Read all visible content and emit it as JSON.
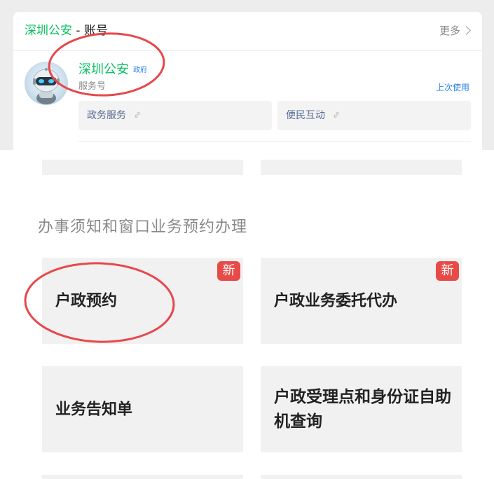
{
  "account_card": {
    "title_prefix": "深圳公安",
    "title_suffix": " - 账号",
    "more_label": "更多",
    "name": "深圳公安",
    "gov_tag": "政府",
    "type": "服务号",
    "last_used": "上次使用",
    "menu": [
      {
        "label": "政务服务",
        "icon": "link-icon"
      },
      {
        "label": "便民互动",
        "icon": "link-icon"
      }
    ]
  },
  "section": {
    "title": "办事须知和窗口业务预约办理",
    "tiles": [
      {
        "label": "户政预约",
        "badge": "新"
      },
      {
        "label": "户政业务委托代办",
        "badge": "新"
      },
      {
        "label": "业务告知单",
        "badge": ""
      },
      {
        "label": "户政受理点和身份证自助机查询",
        "badge": ""
      }
    ]
  },
  "colors": {
    "brand_green": "#07c160",
    "link_blue": "#2a82e4",
    "badge_red": "#e84b47",
    "annotation_red": "#e8474a"
  }
}
